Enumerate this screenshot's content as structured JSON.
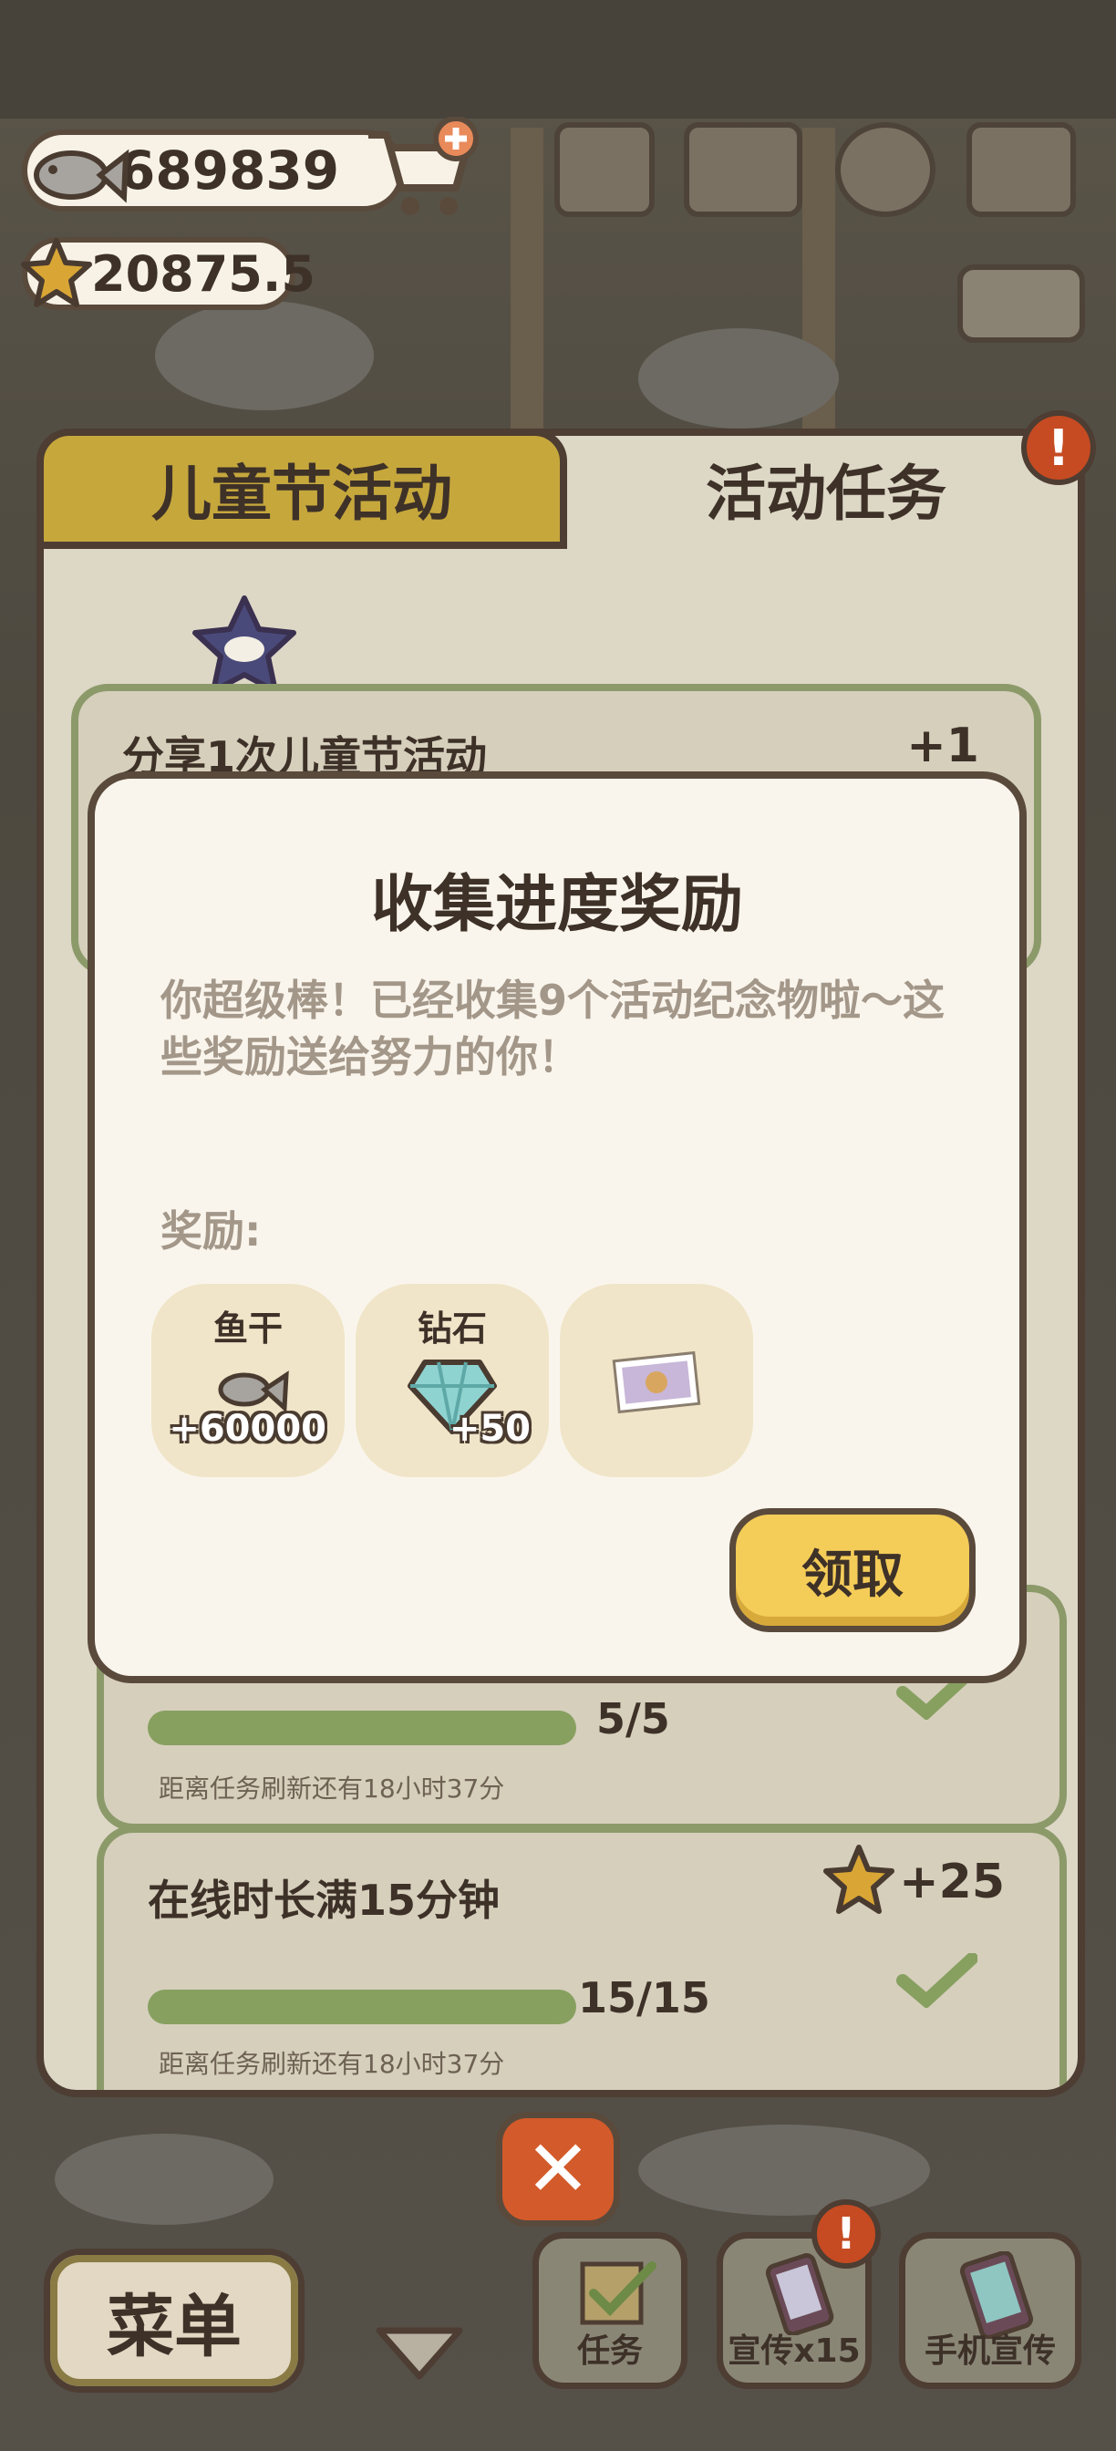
{
  "currency": {
    "fish": "689839",
    "stars": "20875.5"
  },
  "tabs": {
    "left": "儿童节活动",
    "right": "活动任务"
  },
  "tasks": [
    {
      "title": "分享1次儿童节活动",
      "reward": "+1"
    },
    {
      "progress": "5/5",
      "refresh": "距离任务刷新还有18小时37分"
    },
    {
      "title": "在线时长满15分钟",
      "reward": "+25",
      "progress": "15/15",
      "refresh": "距离任务刷新还有18小时37分"
    }
  ],
  "modal": {
    "title": "收集进度奖励",
    "message": "你超级棒！已经收集9个活动纪念物啦～这些奖励送给努力的你！",
    "reward_label": "奖励:",
    "rewards": [
      {
        "name": "鱼干",
        "amount": "+60000",
        "icon": "fish-icon"
      },
      {
        "name": "钻石",
        "amount": "+50",
        "icon": "diamond-icon"
      },
      {
        "name": "",
        "amount": "",
        "icon": "photo-icon"
      }
    ],
    "claim": "领取"
  },
  "alerts": {
    "badge": "!"
  },
  "bottom": {
    "close": "✕",
    "menu": "菜单",
    "task": "任务",
    "promo": "宣传x15",
    "phone_promo": "手机宣传"
  },
  "colors": {
    "tab_active": "#c6a73c",
    "claim_button": "#f4cc58",
    "close_button": "#d35a2a",
    "progress_bar": "#87a060"
  }
}
